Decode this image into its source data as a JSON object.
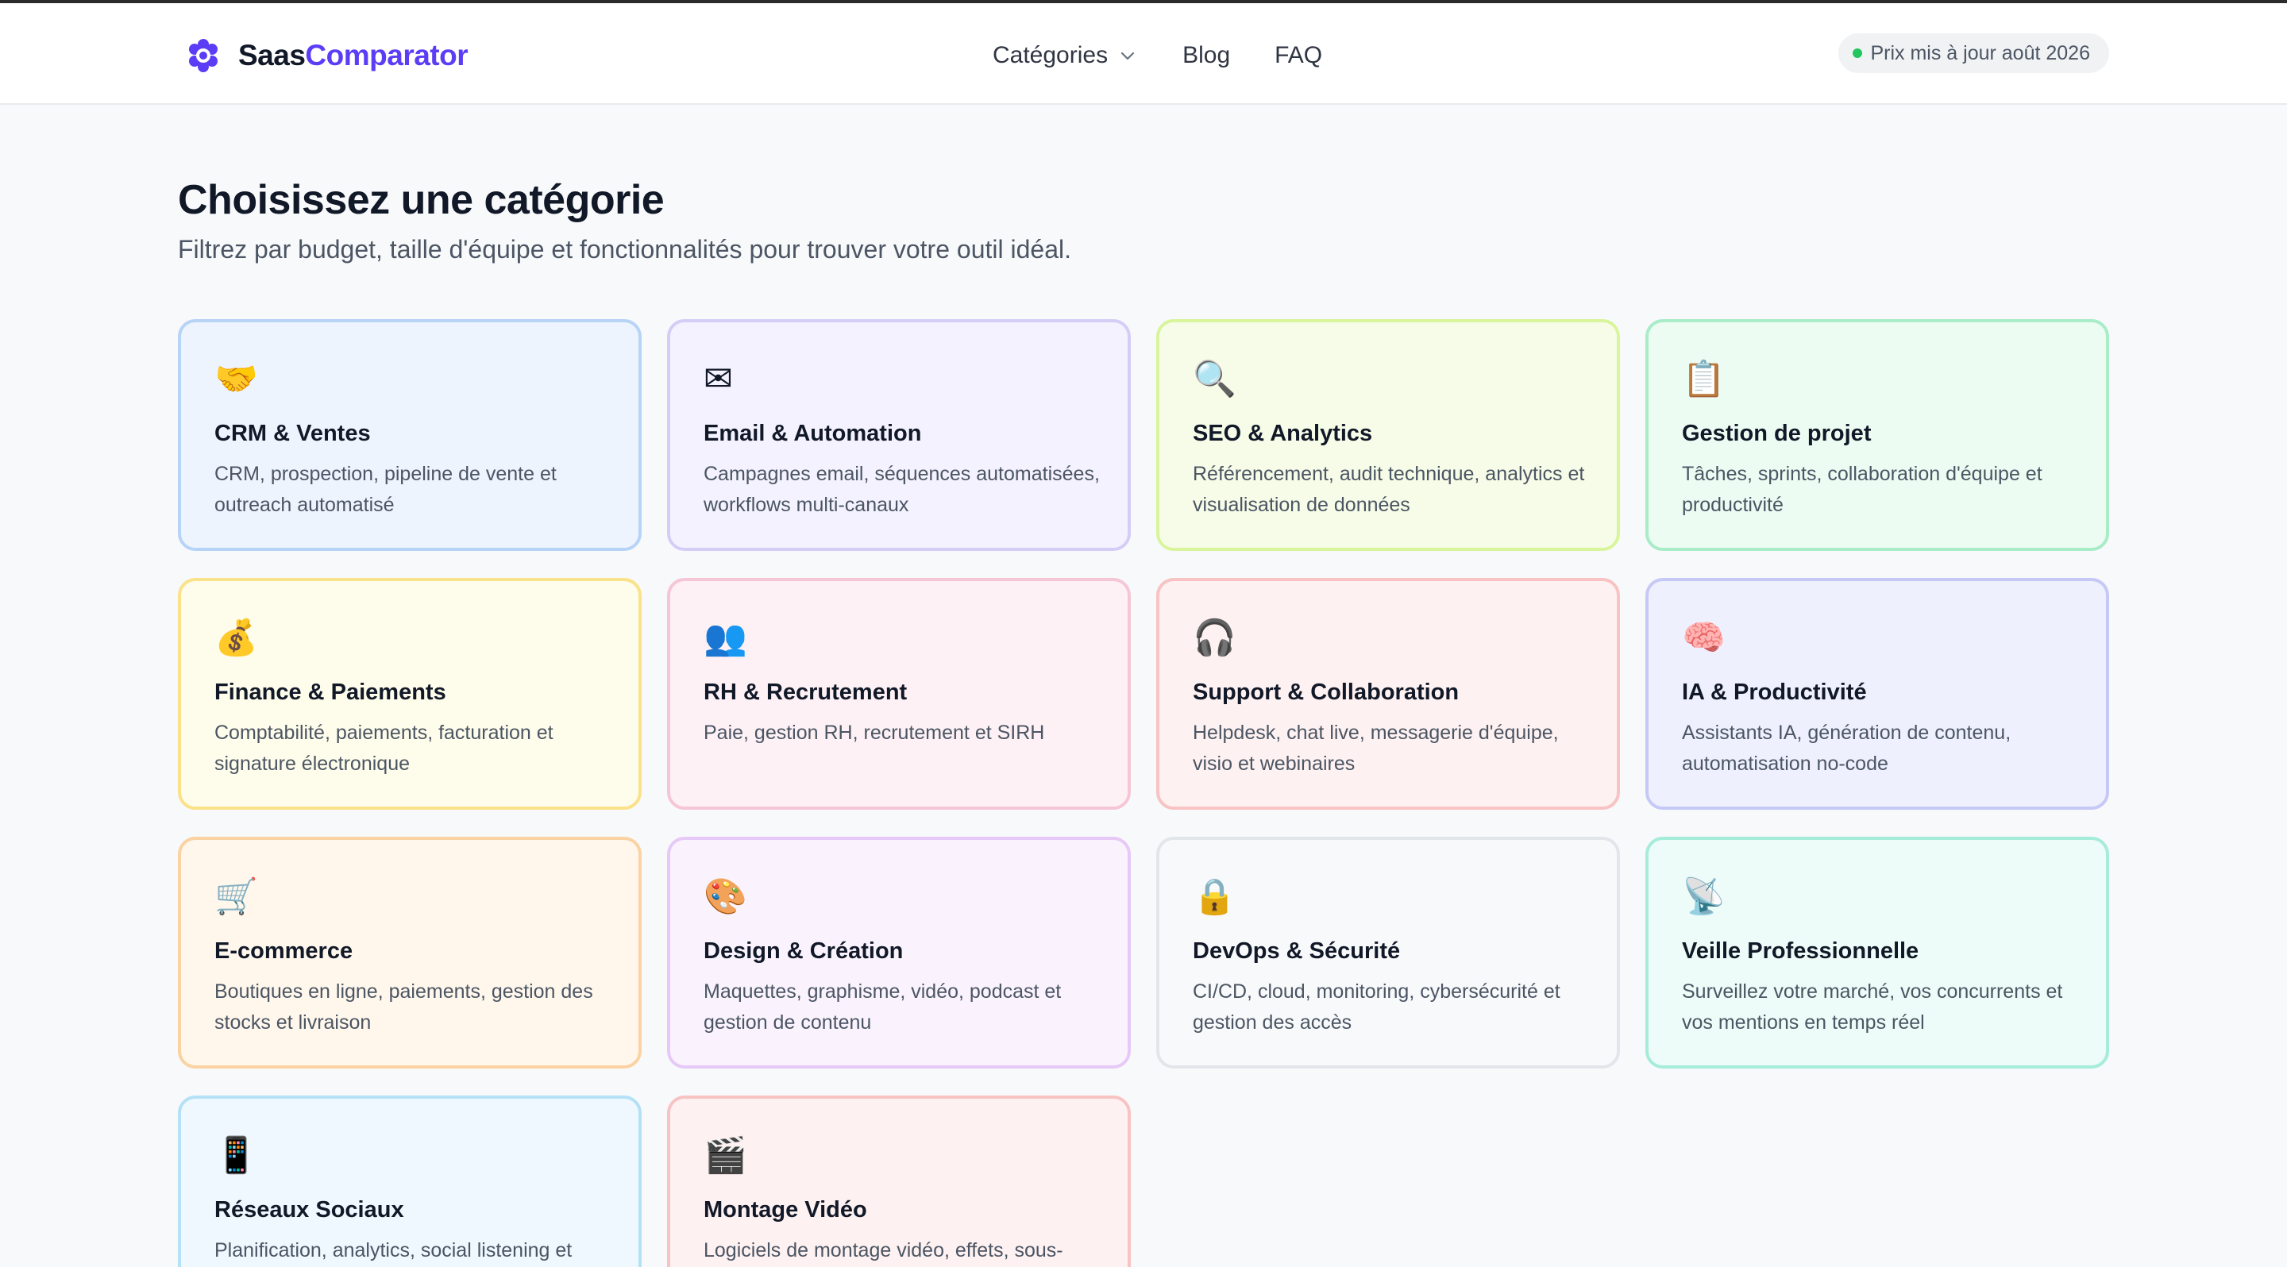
{
  "header": {
    "brand_part1": "Saas",
    "brand_part2": "Comparator",
    "nav": {
      "categories": "Catégories",
      "blog": "Blog",
      "faq": "FAQ"
    },
    "price_badge": "Prix mis à jour août 2026"
  },
  "main": {
    "title": "Choisissez une catégorie",
    "subtitle": "Filtrez par budget, taille d'équipe et fonctionnalités pour trouver votre outil idéal."
  },
  "colors": {
    "brand_accent": "#5b3df5",
    "badge_dot": "#22c55e"
  },
  "categories": [
    {
      "icon": "handshake-icon",
      "emoji": "🤝",
      "name": "CRM & Ventes",
      "desc": "CRM, prospection, pipeline de vente et outreach automatisé",
      "bg": "#eef4fe",
      "border": "#b7d3f6"
    },
    {
      "icon": "envelope-icon",
      "emoji": "✉",
      "name": "Email & Automation",
      "desc": "Campagnes email, séquences automatisées, workflows multi-canaux",
      "bg": "#f4f2fe",
      "border": "#d6cdf7"
    },
    {
      "icon": "magnifier-icon",
      "emoji": "🔍",
      "name": "SEO & Analytics",
      "desc": "Référencement, audit technique, analytics et visualisation de données",
      "bg": "#f6fce7",
      "border": "#d9f59c"
    },
    {
      "icon": "clipboard-icon",
      "emoji": "📋",
      "name": "Gestion de projet",
      "desc": "Tâches, sprints, collaboration d'équipe et productivité",
      "bg": "#edfcf3",
      "border": "#a9ecc8"
    },
    {
      "icon": "money-bag-icon",
      "emoji": "💰",
      "name": "Finance & Paiements",
      "desc": "Comptabilité, paiements, facturation et signature électronique",
      "bg": "#fefcea",
      "border": "#fae28a"
    },
    {
      "icon": "people-icon",
      "emoji": "👥",
      "name": "RH & Recrutement",
      "desc": "Paie, gestion RH, recrutement et SIRH",
      "bg": "#fdf1f5",
      "border": "#f6c6d6"
    },
    {
      "icon": "headphones-icon",
      "emoji": "🎧",
      "name": "Support & Collaboration",
      "desc": "Helpdesk, chat live, messagerie d'équipe, visio et webinaires",
      "bg": "#fef1f1",
      "border": "#f8c3c3"
    },
    {
      "icon": "brain-icon",
      "emoji": "🧠",
      "name": "IA & Productivité",
      "desc": "Assistants IA, génération de contenu, automatisation no-code",
      "bg": "#eff0fe",
      "border": "#c6c9f6"
    },
    {
      "icon": "shopping-cart-icon",
      "emoji": "🛒",
      "name": "E-commerce",
      "desc": "Boutiques en ligne, paiements, gestion des stocks et livraison",
      "bg": "#fff7ec",
      "border": "#fbd2a2"
    },
    {
      "icon": "palette-icon",
      "emoji": "🎨",
      "name": "Design & Création",
      "desc": "Maquettes, graphisme, vidéo, podcast et gestion de contenu",
      "bg": "#faf3fe",
      "border": "#e6c9f6"
    },
    {
      "icon": "lock-icon",
      "emoji": "🔒",
      "name": "DevOps & Sécurité",
      "desc": "CI/CD, cloud, monitoring, cybersécurité et gestion des accès",
      "bg": "#f8f9fb",
      "border": "#e2e5ea"
    },
    {
      "icon": "satellite-dish-icon",
      "emoji": "📡",
      "name": "Veille Professionnelle",
      "desc": "Surveillez votre marché, vos concurrents et vos mentions en temps réel",
      "bg": "#edfcf8",
      "border": "#a5ecd9"
    },
    {
      "icon": "mobile-phone-icon",
      "emoji": "📱",
      "name": "Réseaux Sociaux",
      "desc": "Planification, analytics, social listening et",
      "bg": "#eef8fe",
      "border": "#b4e1f6"
    },
    {
      "icon": "clapper-board-icon",
      "emoji": "🎬",
      "name": "Montage Vidéo",
      "desc": "Logiciels de montage vidéo, effets, sous-",
      "bg": "#fef1f1",
      "border": "#f8c3c3"
    }
  ]
}
